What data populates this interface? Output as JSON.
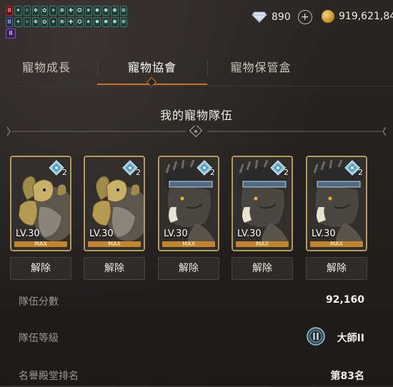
{
  "buffs": {
    "row1": [
      "red",
      "teal",
      "teal",
      "teal",
      "teal",
      "teal",
      "teal",
      "teal",
      "teal",
      "teal",
      "teal",
      "teal",
      "teal",
      "teal"
    ],
    "row2": [
      "blue",
      "teal",
      "teal",
      "teal",
      "teal",
      "teal",
      "teal",
      "teal",
      "teal",
      "teal",
      "teal",
      "teal",
      "teal",
      "teal"
    ],
    "row3": [
      "purple"
    ]
  },
  "currency": {
    "diamond": {
      "icon": "diamond-icon",
      "value": "890"
    },
    "gold": {
      "icon": "gold-coin-icon",
      "value": "919,621,84"
    }
  },
  "tabs": [
    {
      "label": "寵物成長"
    },
    {
      "label": "寵物協會",
      "active": true
    },
    {
      "label": "寵物保管盒"
    }
  ],
  "section": {
    "title": "我的寵物隊伍"
  },
  "pets": [
    {
      "type": "armored-ram",
      "rank": "2",
      "level": "LV.30",
      "max": "MAX",
      "release": "解除"
    },
    {
      "type": "armored-ram",
      "rank": "2",
      "level": "LV.30",
      "max": "MAX",
      "release": "解除"
    },
    {
      "type": "feathered-boar",
      "rank": "2",
      "level": "LV.30",
      "max": "MAX",
      "release": "解除"
    },
    {
      "type": "feathered-boar",
      "rank": "2",
      "level": "LV.30",
      "max": "MAX",
      "release": "解除"
    },
    {
      "type": "feathered-boar",
      "rank": "2",
      "level": "LV.30",
      "max": "MAX",
      "release": "解除"
    }
  ],
  "stats": [
    {
      "label": "隊伍分數",
      "value": "92,160"
    },
    {
      "label": "隊伍等級",
      "value": "大師II",
      "icon": "master-tier-icon"
    },
    {
      "label": "名譽殿堂排名",
      "value": "第83名"
    }
  ],
  "colors": {
    "accent": "#c8752a",
    "card_border": "#b79a5a",
    "max_bar": "#c0852e"
  }
}
